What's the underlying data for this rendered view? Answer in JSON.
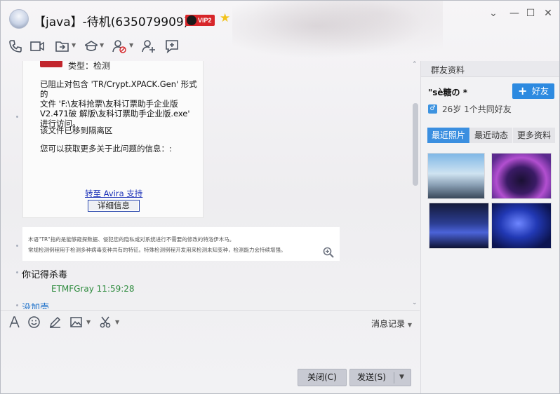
{
  "window": {
    "title": "【java】-待机(635079909)",
    "vip_badge": "VIP2"
  },
  "chat": {
    "alert": {
      "type_line": "类型：检测",
      "blocked_text": "已阻止对包含 'TR/Crypt.XPACK.Gen' 形式的\n文件 'F:\\友科抢票\\友科订票助手企业版\nV2.471破 解版\\友科订票助手企业版.exe'\n进行访问。",
      "moved_text": "该文件已移到隔离区",
      "more_info_text": "您可以获取更多关于此问题的信息：:",
      "avira_link": "转至 Avira 支持",
      "details_button": "详细信息"
    },
    "note_text": "木语\"TR\"指的是能够窥探数据、侵犯您的隐私或对系统进行不需要的修改的特洛伊木马。\n常规检测例程用于检测多种病毒变种共有的特征。特殊检测例程开发用来检测未知变种，检测能力会持续增强。",
    "messages": [
      {
        "text": "你记得杀毒"
      },
      {
        "text": "没加壳"
      }
    ],
    "sender_line": "ETMFGray  11:59:28"
  },
  "composer": {
    "history_label": "消息记录",
    "close_button": "关闭(C)",
    "send_button": "发送(S)"
  },
  "side": {
    "header": "群友资料",
    "nickname": "\"sè糖の *",
    "add_friend": "好友",
    "age_info": "26岁 1个共同好友",
    "tabs": [
      "最近照片",
      "最近动态",
      "更多资料"
    ]
  },
  "colors": {
    "accent": "#2d8ae0",
    "link": "#1b31b8",
    "sender": "#2e8b3e",
    "alert_red": "#c2262d"
  }
}
